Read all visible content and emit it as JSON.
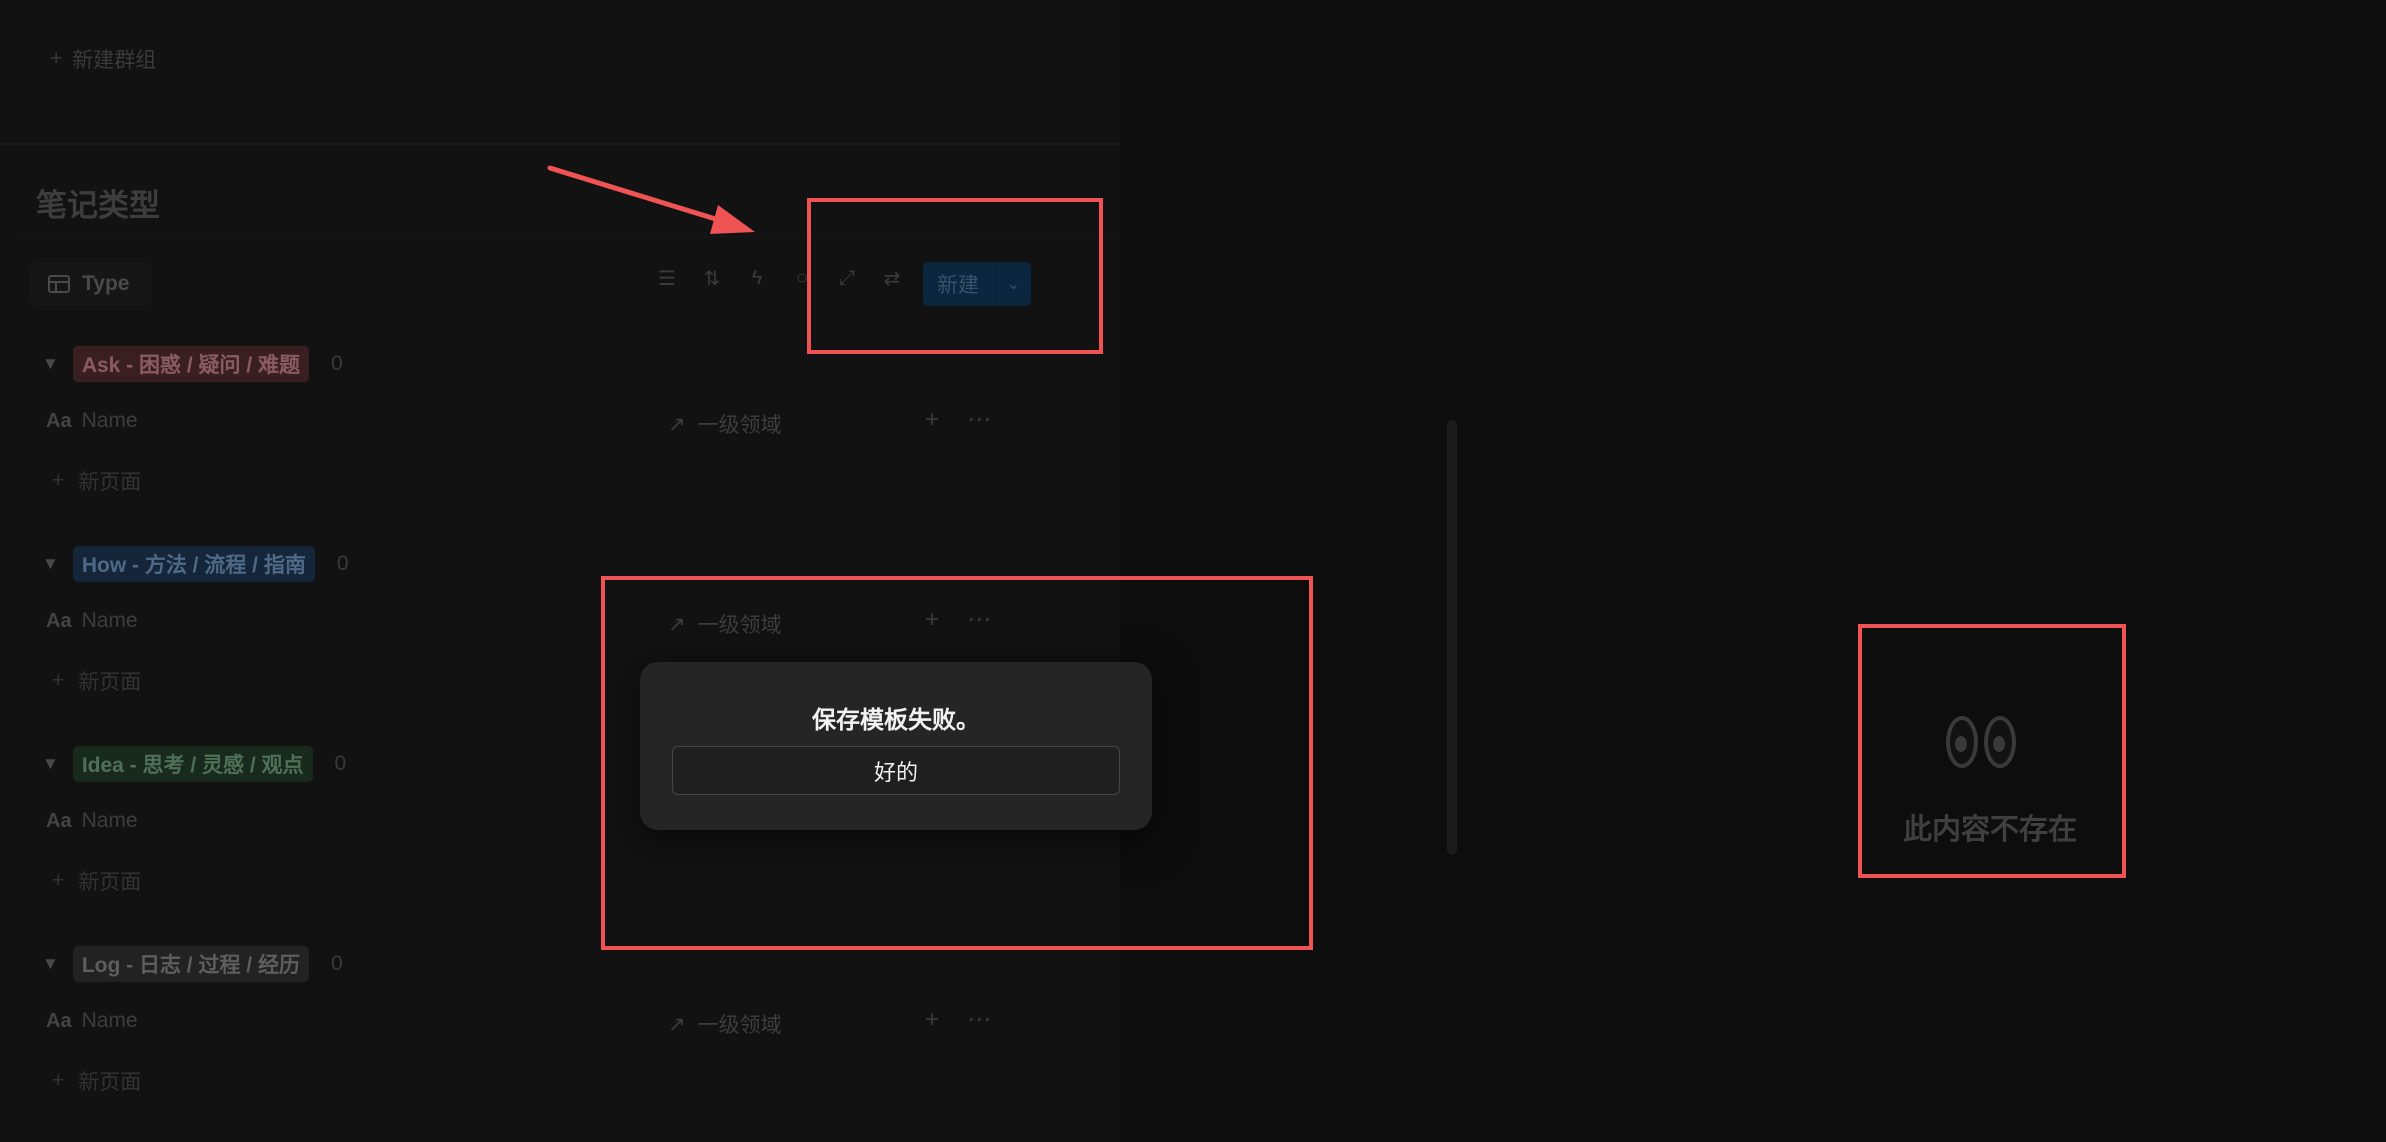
{
  "top": {
    "new_group_label": "新建群组",
    "plus_icon": "plus-icon"
  },
  "section": {
    "title": "笔记类型"
  },
  "view_tab": {
    "label": "Type",
    "icon": "table-icon"
  },
  "toolbar": {
    "icons": [
      "filter-icon",
      "sort-icon",
      "automation-icon",
      "search-icon",
      "expand-icon",
      "sync-icon"
    ],
    "new_label": "新建",
    "new_chevron": "chevron-down-icon"
  },
  "groups": [
    {
      "tag": "Ask - 困惑 / 疑问 / 难题",
      "count": "0",
      "color": "#5a2a2f",
      "text_color": "#a07078",
      "name_label": "Name",
      "name_icon_text": "Aa",
      "prop_label": "一级领域",
      "new_page_label": "新页面"
    },
    {
      "tag": "How - 方法 / 流程 / 指南",
      "count": "0",
      "color": "#1e3147",
      "text_color": "#6d8aa8",
      "name_label": "Name",
      "name_icon_text": "Aa",
      "prop_label": "一级领域",
      "new_page_label": "新页面"
    },
    {
      "tag": "Idea - 思考 / 灵感 / 观点",
      "count": "0",
      "color": "#1f3526",
      "text_color": "#6e9478",
      "name_label": "Name",
      "name_icon_text": "Aa",
      "prop_label": "一级领域",
      "new_page_label": "新页面"
    },
    {
      "tag": "Log - 日志 / 过程 / 经历",
      "count": "0",
      "color": "#2b2b2b",
      "text_color": "#7a7a7a",
      "name_label": "Name",
      "name_icon_text": "Aa",
      "prop_label": "一级领域",
      "new_page_label": "新页面"
    }
  ],
  "right": {
    "missing_text": "此内容不存在",
    "icon": "eyes-icon"
  },
  "dialog": {
    "message": "保存模板失败。",
    "ok_label": "好的"
  },
  "annotation": {
    "color": "#ef5353"
  }
}
